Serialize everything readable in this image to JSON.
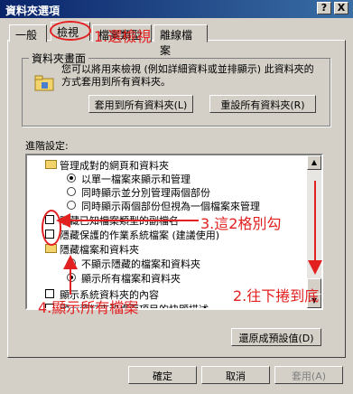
{
  "window": {
    "title": "資料夾選項",
    "help_btn": "?",
    "close_btn": "X"
  },
  "tabs": [
    "一般",
    "檢視",
    "檔案類型",
    "離線檔案"
  ],
  "folder_view": {
    "group_title": "資料夾畫面",
    "description": "您可以將用來檢視 (例如詳細資料或並排顯示) 此資料夾的方式套用到所有資料夾。",
    "apply_all_btn": "套用到所有資料夾(L)",
    "reset_all_btn": "重設所有資料夾(R)"
  },
  "advanced": {
    "label": "進階設定:",
    "items": [
      {
        "type": "folder",
        "text": "管理成對的網頁和資料夾"
      },
      {
        "type": "radio",
        "checked": true,
        "text": "以單一檔案來顯示和管理"
      },
      {
        "type": "radio",
        "checked": false,
        "text": "同時顯示並分別管理兩個部份"
      },
      {
        "type": "radio",
        "checked": false,
        "text": "同時顯示兩個部份但視為一個檔案來管理"
      },
      {
        "type": "check",
        "checked": false,
        "text": "隱藏已知檔案類型的副檔名"
      },
      {
        "type": "check",
        "checked": false,
        "text": "隱藏保護的作業系統檔案 (建議使用)"
      },
      {
        "type": "folder",
        "text": "隱藏檔案和資料夾"
      },
      {
        "type": "radio",
        "checked": false,
        "text": "不顯示隱藏的檔案和資料夾"
      },
      {
        "type": "radio",
        "checked": true,
        "text": "顯示所有檔案和資料夾"
      },
      {
        "type": "check",
        "checked": false,
        "text": "顯示系統資料夾的內容"
      },
      {
        "type": "check",
        "checked": false,
        "text": "顯示資料夾和桌面項目的快顯描述。"
      }
    ]
  },
  "restore_defaults_btn": "還原成預設值(D)",
  "footer": {
    "ok": "確定",
    "cancel": "取消",
    "apply": "套用(A)"
  },
  "annotations": {
    "step1": "1.選檢視",
    "step2": "2.往下捲到底",
    "step3": "3.這2格別勾",
    "step4": "4.顯示所有檔案"
  }
}
